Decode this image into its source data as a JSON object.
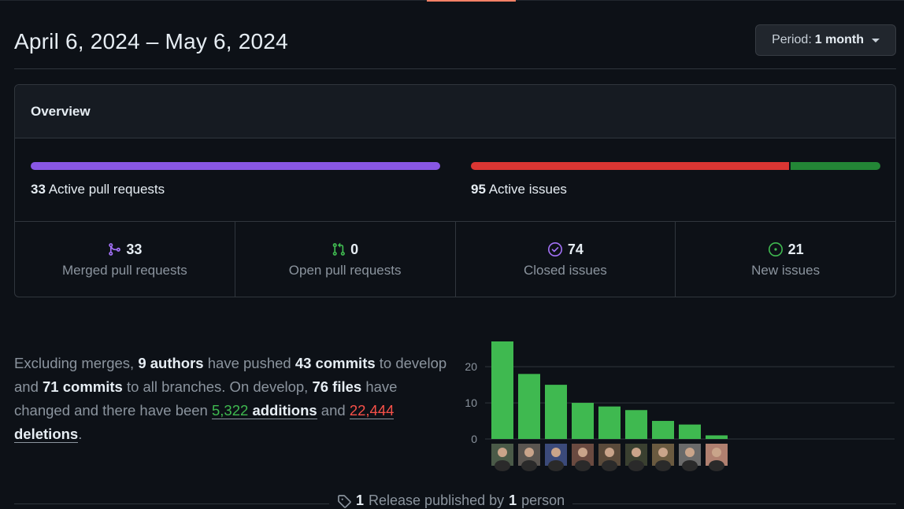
{
  "header": {
    "date_range": "April 6, 2024 – May 6, 2024",
    "period_label": "Period:",
    "period_value": "1 month"
  },
  "overview": {
    "title": "Overview",
    "pull_requests": {
      "count": "33",
      "label": "Active pull requests",
      "bar": [
        {
          "fraction": 1.0,
          "color": "#8957e5"
        }
      ]
    },
    "issues": {
      "count": "95",
      "label": "Active issues",
      "bar": [
        {
          "fraction": 0.779,
          "color": "#da3633"
        },
        {
          "fraction": 0.221,
          "color": "#238636"
        }
      ]
    },
    "stats": [
      {
        "icon": "git-merge-icon",
        "value": "33",
        "label": "Merged pull requests",
        "color": "#a371f7"
      },
      {
        "icon": "git-pull-request-icon",
        "value": "0",
        "label": "Open pull requests",
        "color": "#3fb950"
      },
      {
        "icon": "issue-closed-icon",
        "value": "74",
        "label": "Closed issues",
        "color": "#a371f7"
      },
      {
        "icon": "issue-opened-icon",
        "value": "21",
        "label": "New issues",
        "color": "#3fb950"
      }
    ]
  },
  "summary": {
    "t1": "Excluding merges, ",
    "authors": "9 authors",
    "t2": " have pushed ",
    "commits_branch": "43 commits",
    "t3": " to develop and ",
    "commits_all": "71 commits",
    "t4": " to all branches. On develop, ",
    "files": "76 files",
    "t5": " have changed and there have been ",
    "additions_num": "5,322",
    "additions_word": "additions",
    "t6": " and ",
    "deletions_num": "22,444",
    "deletions_word": "deletions",
    "t7": "."
  },
  "chart_data": {
    "type": "bar",
    "values": [
      27,
      18,
      15,
      10,
      9,
      8,
      5,
      4,
      1
    ],
    "yticks": [
      "0",
      "10",
      "20"
    ],
    "ylim": [
      0,
      27
    ],
    "bar_color": "#3fb950",
    "grid": true
  },
  "footer": {
    "releases": "1",
    "text1": "Release published by",
    "people": "1",
    "text2": "person"
  }
}
